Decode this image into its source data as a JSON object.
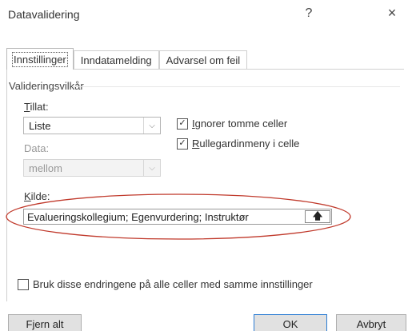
{
  "window": {
    "title": "Datavalidering",
    "help_label": "?",
    "close_label": "×"
  },
  "tabs": [
    {
      "label": "Innstillinger",
      "active": true
    },
    {
      "label": "Inndatamelding",
      "active": false
    },
    {
      "label": "Advarsel om feil",
      "active": false
    }
  ],
  "validation": {
    "section_title": "Valideringsvilkår",
    "allow_label": "Tillat:",
    "allow_value": "Liste",
    "data_label": "Data:",
    "data_value": "mellom",
    "ignore_blank_label": "Ignorer tomme celler",
    "ignore_blank_checked": true,
    "dropdown_label": "Rullegardinmeny i celle",
    "dropdown_checked": true,
    "source_label": "Kilde:",
    "source_value": "Evalueringskollegium; Egenvurdering; Instruktør",
    "ref_button_icon": "collapse-up-icon"
  },
  "apply_all": {
    "label": "Bruk disse endringene på alle celler med samme innstillinger",
    "checked": false
  },
  "buttons": {
    "clear_all": "Fjern alt",
    "ok": "OK",
    "cancel": "Avbryt"
  },
  "colors": {
    "annotation_ellipse": "#c0392b",
    "default_button_border": "#2b7cd3"
  }
}
